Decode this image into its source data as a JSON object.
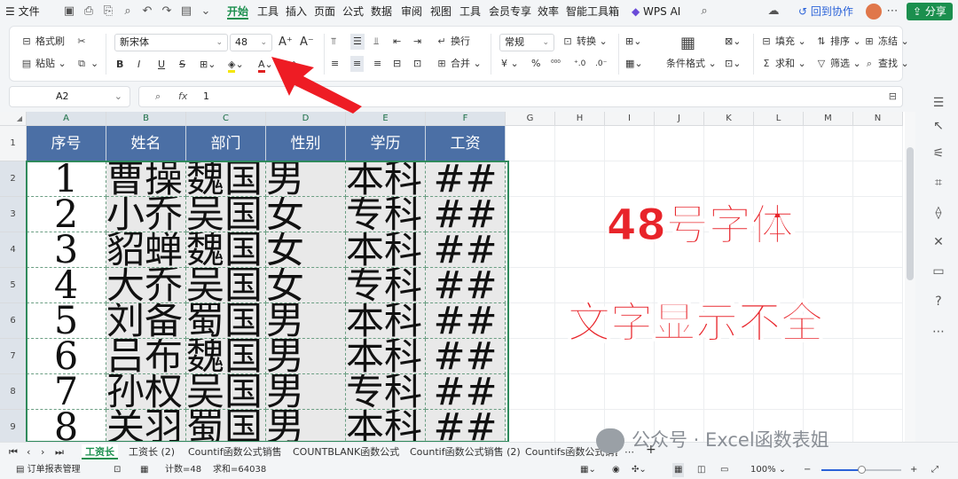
{
  "menubar": {
    "file": "文件",
    "tabs": [
      "开始",
      "工具",
      "插入",
      "页面",
      "公式",
      "数据",
      "审阅",
      "视图",
      "工具",
      "会员专享",
      "效率",
      "智能工具箱"
    ],
    "wps_ai": "WPS AI",
    "collab": "回到协作",
    "share": "分享"
  },
  "ribbon": {
    "format_painter": "格式刷",
    "paste": "粘贴",
    "font_name": "新宋体",
    "font_size": "48",
    "wrap": "换行",
    "merge": "合并",
    "number_format": "常规",
    "convert": "转换",
    "conditional_format": "条件格式",
    "fill": "填充",
    "sort": "排序",
    "freeze": "冻结",
    "sum": "求和",
    "filter": "筛选",
    "find": "查找",
    "bold": "B",
    "italic": "I",
    "underline": "U",
    "strike": "S",
    "currency": "¥",
    "percent": "%"
  },
  "formula_bar": {
    "name_box": "A2",
    "fx": "fx",
    "value": "1"
  },
  "sheet": {
    "columns": [
      "A",
      "B",
      "C",
      "D",
      "E",
      "F",
      "G",
      "H",
      "I",
      "J",
      "K",
      "L",
      "M",
      "N"
    ],
    "rows": [
      "1",
      "2",
      "3",
      "4",
      "5",
      "6",
      "7",
      "8",
      "9"
    ],
    "headers": [
      "序号",
      "姓名",
      "部门",
      "性别",
      "学历",
      "工资"
    ],
    "data": [
      [
        "1",
        "曹操",
        "魏国",
        "男",
        "本科",
        "##"
      ],
      [
        "2",
        "小乔",
        "吴国",
        "女",
        "专科",
        "##"
      ],
      [
        "3",
        "貂蝉",
        "魏国",
        "女",
        "本科",
        "##"
      ],
      [
        "4",
        "大乔",
        "吴国",
        "女",
        "专科",
        "##"
      ],
      [
        "5",
        "刘备",
        "蜀国",
        "男",
        "本科",
        "##"
      ],
      [
        "6",
        "吕布",
        "魏国",
        "男",
        "本科",
        "##"
      ],
      [
        "7",
        "孙权",
        "吴国",
        "男",
        "专科",
        "##"
      ],
      [
        "8",
        "关羽",
        "蜀国",
        "男",
        "本科",
        "##"
      ]
    ]
  },
  "callouts": {
    "line1": "48号字体",
    "line2": "文字显示不全"
  },
  "sheet_tabs": [
    "工资长",
    "工资长 (2)",
    "Countif函数公式销售",
    "COUNTBLANK函数公式",
    "Countif函数公式销售 (2)",
    "Countifs函数公式销售"
  ],
  "status": {
    "doc_name": "订单报表管理",
    "count": "计数=48",
    "sum": "求和=64038",
    "zoom": "100%"
  },
  "watermark": "公众号 · Excel函数表姐",
  "colors": {
    "accent": "#1b8f4e",
    "header_fill": "#4b6fa5",
    "callout_red": "#e8242a",
    "arrow_red": "#ee1c24"
  }
}
